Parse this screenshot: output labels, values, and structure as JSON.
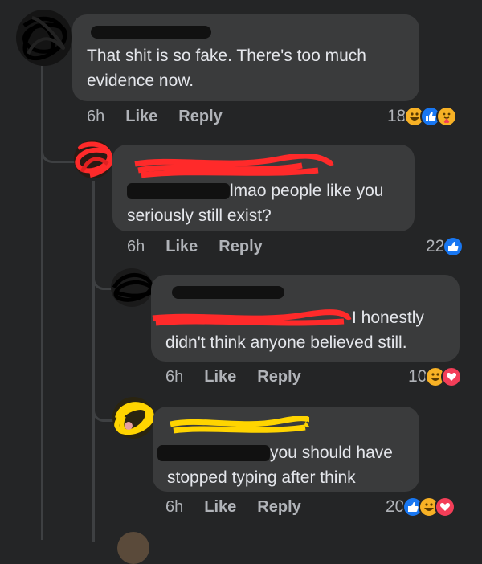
{
  "comments": [
    {
      "text": "That shit is so fake. There's too much evidence now.",
      "time": "6h",
      "like_label": "Like",
      "reply_label": "Reply",
      "reaction_count": "18",
      "reactions": [
        "haha-icon",
        "like-icon",
        "care-icon"
      ]
    },
    {
      "text_after_mention": "lmao people like you seriously still exist?",
      "time": "6h",
      "like_label": "Like",
      "reply_label": "Reply",
      "reaction_count": "22",
      "reactions": [
        "like-icon"
      ]
    },
    {
      "text_after_mention": "I honestly didn't think anyone believed still.",
      "time": "6h",
      "like_label": "Like",
      "reply_label": "Reply",
      "reaction_count": "10",
      "reactions": [
        "haha-icon",
        "love-icon"
      ]
    },
    {
      "text_after_mention": "you should have stopped typing after think",
      "time": "6h",
      "like_label": "Like",
      "reply_label": "Reply",
      "reaction_count": "20",
      "reactions": [
        "like-icon",
        "haha-icon",
        "love-icon"
      ]
    }
  ],
  "colors": {
    "background": "#242526",
    "bubble": "#3a3b3c",
    "text": "#e4e6eb",
    "meta": "#b0b3b8",
    "like_blue": "#1877f2",
    "haha_yellow": "#f7b125",
    "love_red": "#f33e58",
    "redaction_black": "#111111",
    "redaction_red": "#ff2a2a",
    "redaction_yellow": "#ffd400"
  }
}
